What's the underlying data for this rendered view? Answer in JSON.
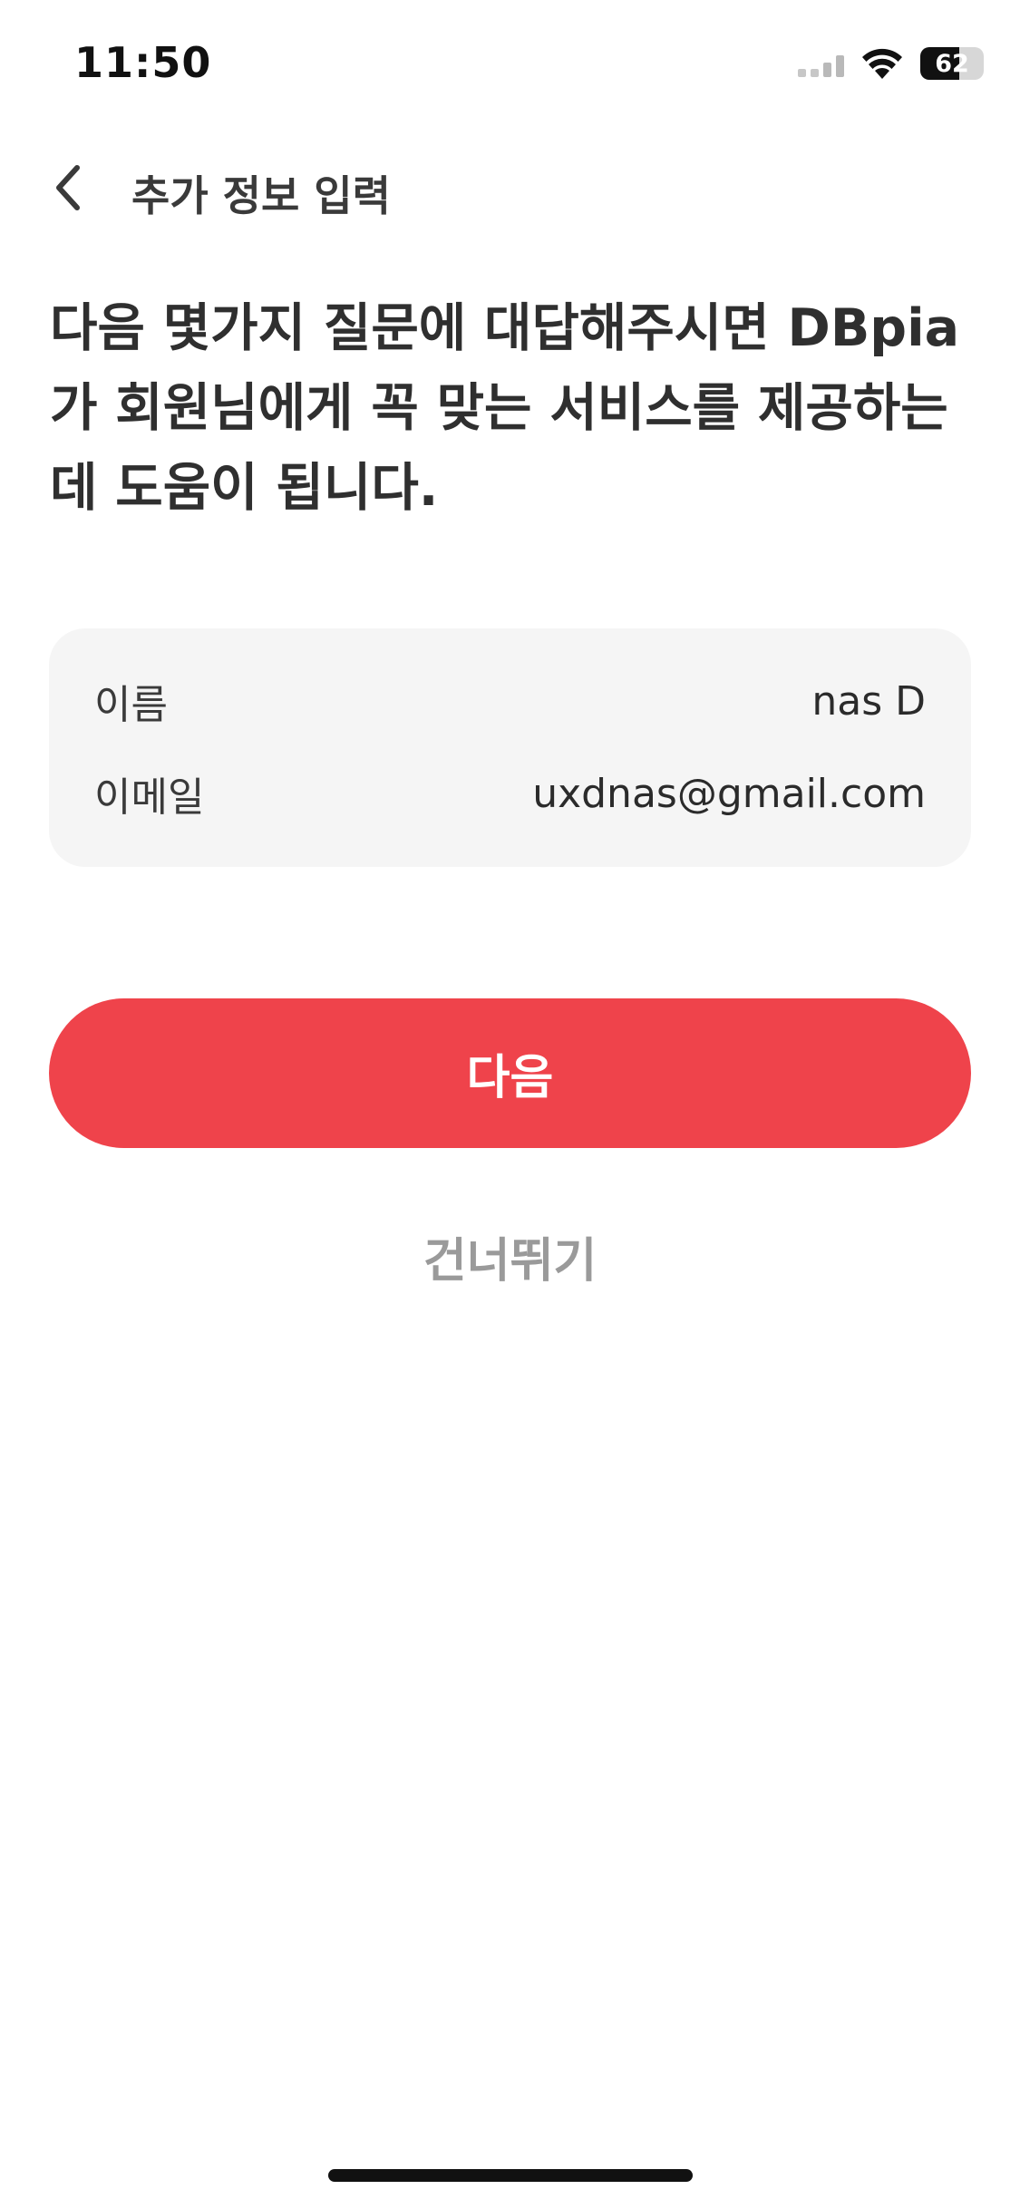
{
  "status_bar": {
    "time": "11:50",
    "battery_level": "62"
  },
  "header": {
    "title": "추가 정보 입력",
    "back_icon": "chevron-left-icon"
  },
  "intro": {
    "text": "다음 몇가지 질문에 대답해주시면 DBpia가 회원님에게 꼭 맞는 서비스를 제공하는데 도움이 됩니다."
  },
  "info_card": {
    "name_label": "이름",
    "name_value": "nas D",
    "email_label": "이메일",
    "email_value": "uxdnas@gmail.com"
  },
  "actions": {
    "next_label": "다음",
    "skip_label": "건너뛰기"
  },
  "colors": {
    "accent": "#ef434b",
    "card_bg": "#f5f5f5",
    "skip_text": "#9a9a9a"
  }
}
